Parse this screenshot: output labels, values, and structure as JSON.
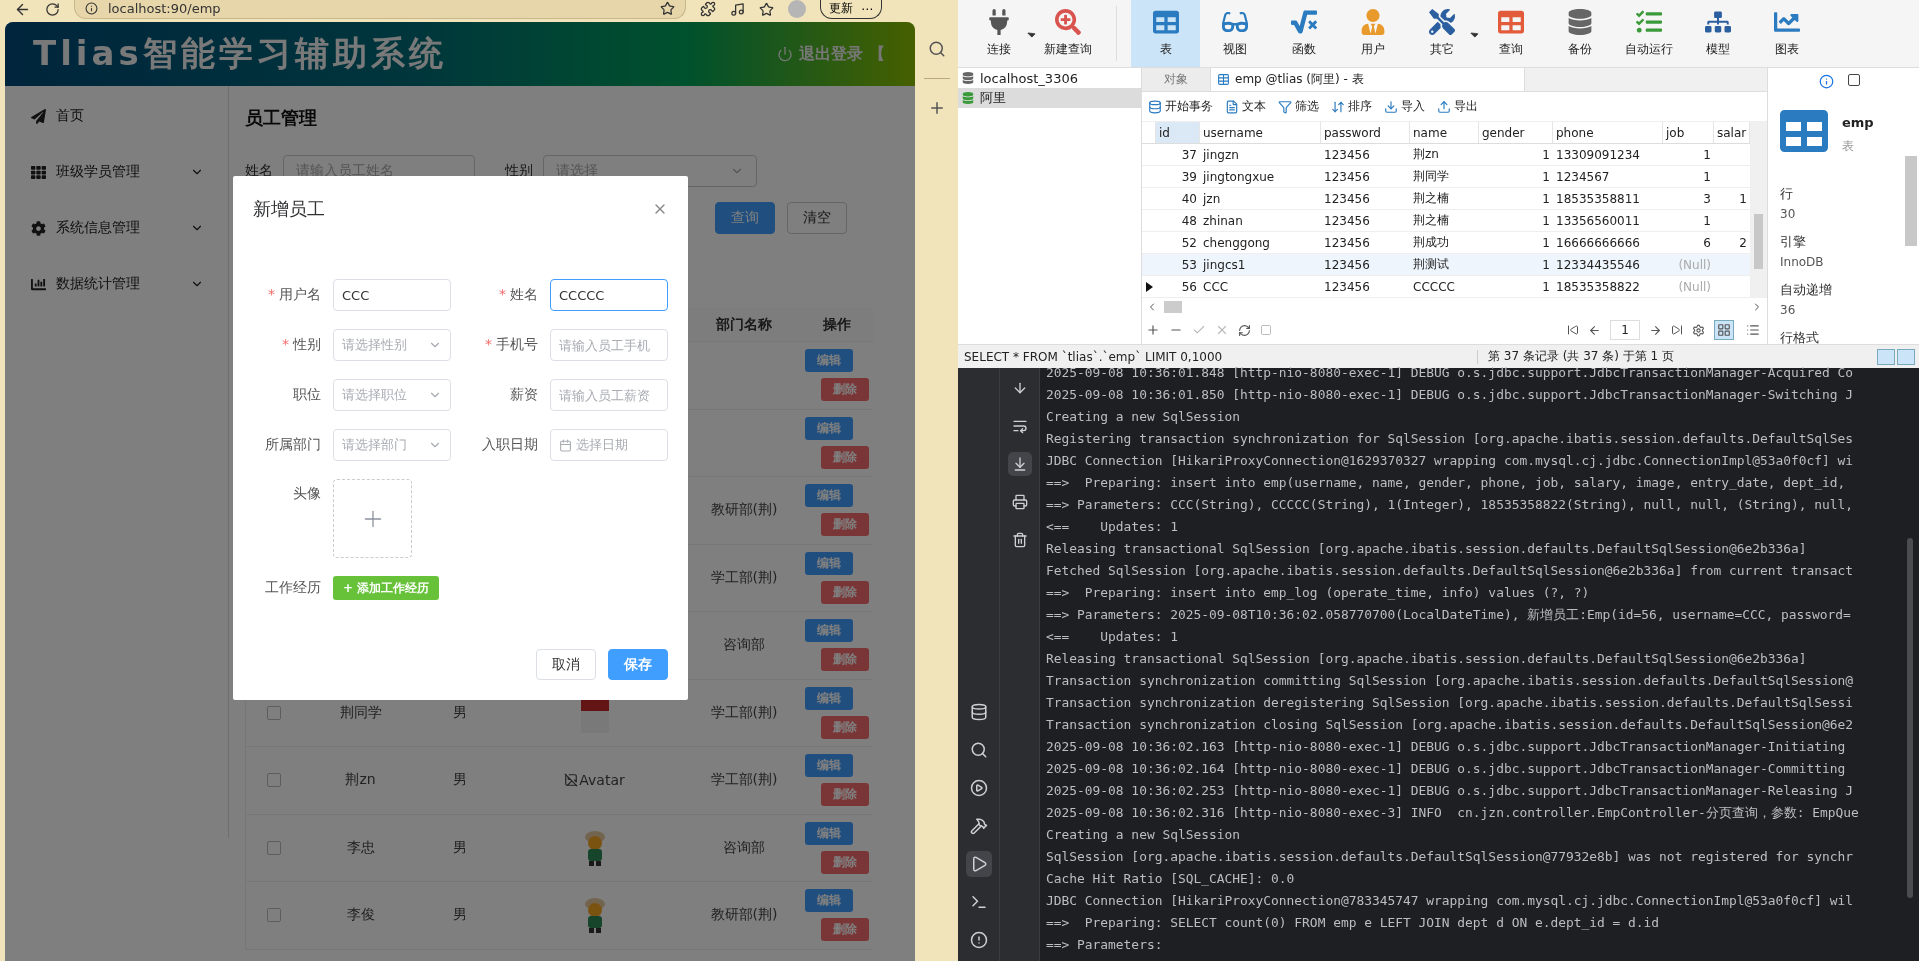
{
  "browser": {
    "url": "localhost:90/emp",
    "update_button": "更新",
    "more_button": "⋯"
  },
  "app": {
    "title": "Tlias智能学习辅助系统",
    "logout": "退出登录",
    "logout_extra": "【",
    "menu": [
      {
        "label": "首页",
        "kind": "home",
        "expandable": false
      },
      {
        "label": "班级学员管理",
        "kind": "grid",
        "expandable": true
      },
      {
        "label": "系统信息管理",
        "kind": "settings",
        "expandable": true
      },
      {
        "label": "数据统计管理",
        "kind": "chart",
        "expandable": true
      }
    ],
    "page": {
      "title": "员工管理",
      "search_fields": [
        {
          "label": "姓名",
          "kind": "input",
          "placeholder": "请输入员工姓名"
        },
        {
          "label": "性别",
          "kind": "select",
          "placeholder": "请选择"
        }
      ],
      "buttons": [
        {
          "label": "查询",
          "primary": true
        },
        {
          "label": "清空",
          "primary": false
        }
      ],
      "table": {
        "columns": [
          "部门名称",
          "操作"
        ],
        "rows": [
          {
            "edit": "编辑",
            "delete": "删除"
          },
          {
            "edit": "编辑",
            "delete": "删除"
          },
          {
            "dept": "教研部(荆)",
            "edit": "编辑",
            "delete": "删除"
          },
          {
            "dept": "学工部(荆)",
            "edit": "编辑",
            "delete": "删除"
          },
          {
            "dept": "咨询部",
            "edit": "编辑",
            "delete": "删除"
          },
          {
            "checked": false,
            "name": "荆同学",
            "gender": "男",
            "kind": "photo",
            "dept": "学工部(荆)",
            "edit": "编辑",
            "delete": "删除"
          },
          {
            "checked": false,
            "name": "荆zn",
            "gender": "男",
            "kind": "broken",
            "image_alt": "Avatar",
            "dept": "学工部(荆)",
            "edit": "编辑",
            "delete": "删除"
          },
          {
            "checked": false,
            "name": "李忠",
            "gender": "男",
            "kind": "cartoon",
            "dept": "咨询部",
            "edit": "编辑",
            "delete": "删除"
          },
          {
            "checked": false,
            "name": "李俊",
            "gender": "男",
            "kind": "cartoon",
            "dept": "教研部(荆)",
            "edit": "编辑",
            "delete": "删除"
          }
        ]
      }
    },
    "dialog": {
      "title": "新增员工",
      "fields": [
        {
          "label": "用户名",
          "required_mark": "*",
          "kind": "input",
          "value": "CCC",
          "focused": false
        },
        {
          "label": "姓名",
          "required_mark": "*",
          "kind": "input",
          "value": "CCCCC",
          "focused": true
        },
        {
          "label": "性别",
          "required_mark": "*",
          "kind": "select",
          "placeholder": "请选择性别",
          "focused": false
        },
        {
          "label": "手机号",
          "required_mark": "*",
          "kind": "input",
          "placeholder": "请输入员工手机",
          "focused": false
        },
        {
          "label": "职位",
          "kind": "select",
          "placeholder": "请选择职位",
          "focused": false
        },
        {
          "label": "薪资",
          "kind": "input",
          "placeholder": "请输入员工薪资",
          "focused": false
        },
        {
          "label": "所属部门",
          "kind": "select",
          "placeholder": "请选择部门",
          "focused": false
        },
        {
          "label": "入职日期",
          "kind": "date",
          "placeholder": "选择日期",
          "focused": false
        }
      ],
      "avatar_label": "头像",
      "experience_label": "工作经历",
      "add_experience_button": "+ 添加工作经历",
      "cancel_button": "取消",
      "save_button": "保存"
    }
  },
  "navicat": {
    "toolbar": [
      {
        "label": "连接",
        "kind": "connect",
        "selected": false,
        "dropdown": true
      },
      {
        "label": "新建查询",
        "kind": "new-query",
        "selected": false,
        "dropdown": false
      },
      {
        "label": "表",
        "kind": "table",
        "selected": true,
        "dropdown": false
      },
      {
        "label": "视图",
        "kind": "view",
        "selected": false,
        "dropdown": false
      },
      {
        "label": "函数",
        "kind": "function",
        "selected": false,
        "dropdown": false
      },
      {
        "label": "用户",
        "kind": "user",
        "selected": false,
        "dropdown": false
      },
      {
        "label": "其它",
        "kind": "other",
        "selected": false,
        "dropdown": true
      },
      {
        "label": "查询",
        "kind": "query",
        "selected": false,
        "dropdown": false
      },
      {
        "label": "备份",
        "kind": "backup",
        "selected": false,
        "dropdown": false
      },
      {
        "label": "自动运行",
        "kind": "auto",
        "selected": false,
        "dropdown": false
      },
      {
        "label": "模型",
        "kind": "model",
        "selected": false,
        "dropdown": false
      },
      {
        "label": "图表",
        "kind": "chart",
        "selected": false,
        "dropdown": false
      }
    ],
    "connections": [
      {
        "label": "localhost_3306",
        "selected": false
      },
      {
        "label": "阿里",
        "selected": true
      }
    ],
    "tabs": [
      {
        "label": "对象",
        "selected": false
      },
      {
        "label": "emp @tlias (阿里) - 表",
        "selected": true
      }
    ],
    "actions": [
      {
        "label": "开始事务",
        "kind": "begin"
      },
      {
        "label": "文本",
        "kind": "text"
      },
      {
        "label": "筛选",
        "kind": "filter"
      },
      {
        "label": "排序",
        "kind": "sort"
      },
      {
        "label": "导入",
        "kind": "import"
      },
      {
        "label": "导出",
        "kind": "export"
      }
    ],
    "grid": {
      "columns": [
        "id",
        "username",
        "password",
        "name",
        "gender",
        "phone",
        "job",
        "salar"
      ],
      "rows": [
        {
          "id": "37",
          "username": "jingzn",
          "password": "123456",
          "name": "荆zn",
          "gender": "1",
          "phone": "13309091234",
          "job": "1",
          "job_null": false,
          "current": false,
          "hovered": false
        },
        {
          "id": "39",
          "username": "jingtongxue",
          "password": "123456",
          "name": "荆同学",
          "gender": "1",
          "phone": "1234567",
          "job": "1",
          "job_null": false,
          "current": false,
          "hovered": false
        },
        {
          "id": "40",
          "username": "jzn",
          "password": "123456",
          "name": "荆之楠",
          "gender": "1",
          "phone": "18535358811",
          "job": "3",
          "job_null": false,
          "salary": "1",
          "current": false,
          "hovered": false
        },
        {
          "id": "48",
          "username": "zhinan",
          "password": "123456",
          "name": "荆之楠",
          "gender": "1",
          "phone": "13356560011",
          "job": "1",
          "job_null": false,
          "current": false,
          "hovered": false
        },
        {
          "id": "52",
          "username": "chenggong",
          "password": "123456",
          "name": "荆成功",
          "gender": "1",
          "phone": "16666666666",
          "job": "6",
          "job_null": false,
          "salary": "2",
          "current": false,
          "hovered": false
        },
        {
          "id": "53",
          "username": "jingcs1",
          "password": "123456",
          "name": "荆测试",
          "gender": "1",
          "phone": "12334435546",
          "job": "(Null)",
          "job_null": true,
          "current": false,
          "hovered": true
        },
        {
          "id": "56",
          "username": "CCC",
          "password": "123456",
          "name": "CCCCC",
          "gender": "1",
          "phone": "18535358822",
          "job": "(Null)",
          "job_null": true,
          "current": true,
          "hovered": false
        }
      ]
    },
    "page_number": "1",
    "info": {
      "name": "emp",
      "type": "表",
      "props": [
        {
          "label": "行",
          "value": "30"
        },
        {
          "label": "引擎",
          "value": "InnoDB"
        },
        {
          "label": "自动递增",
          "value": "36"
        },
        {
          "label": "行格式"
        }
      ]
    },
    "status_sql": "SELECT * FROM `tlias`.`emp` LIMIT 0,1000",
    "status_records": "第 37 条记录 (共 37 条) 于第 1 页"
  },
  "console": {
    "bar_tools": [
      {
        "kind": "down",
        "selected": false
      },
      {
        "kind": "wrap",
        "selected": false
      },
      {
        "kind": "scroll-end",
        "selected": true
      },
      {
        "kind": "print",
        "selected": false
      },
      {
        "kind": "trash",
        "selected": false
      }
    ],
    "side_tools": [
      {
        "kind": "database",
        "selected": false
      },
      {
        "kind": "search",
        "selected": false
      },
      {
        "kind": "services",
        "selected": false
      },
      {
        "kind": "build",
        "selected": false
      },
      {
        "kind": "run",
        "selected": true
      },
      {
        "kind": "terminal",
        "selected": false
      },
      {
        "kind": "problems",
        "selected": false
      }
    ],
    "lines": [
      "2025-09-08 10:36:01.848 [http-nio-8080-exec-1] DEBUG o.s.jdbc.support.JdbcTransactionManager-Acquired Co",
      "2025-09-08 10:36:01.850 [http-nio-8080-exec-1] DEBUG o.s.jdbc.support.JdbcTransactionManager-Switching J",
      "Creating a new SqlSession",
      "Registering transaction synchronization for SqlSession [org.apache.ibatis.session.defaults.DefaultSqlSes",
      "JDBC Connection [HikariProxyConnection@1629370327 wrapping com.mysql.cj.jdbc.ConnectionImpl@53a0f0cf] wi",
      "==>  Preparing: insert into emp(username, name, gender, phone, job, salary, image, entry_date, dept_id,",
      "==> Parameters: CCC(String), CCCCC(String), 1(Integer), 18535358822(String), null, null, (String), null,",
      "<==    Updates: 1",
      "Releasing transactional SqlSession [org.apache.ibatis.session.defaults.DefaultSqlSession@6e2b336a]",
      "Fetched SqlSession [org.apache.ibatis.session.defaults.DefaultSqlSession@6e2b336a] from current transact",
      "==>  Preparing: insert into emp_log (operate_time, info) values (?, ?)",
      "==> Parameters: 2025-09-08T10:36:02.058770700(LocalDateTime), 新增员工:Emp(id=56, username=CCC, password=",
      "<==    Updates: 1",
      "Releasing transactional SqlSession [org.apache.ibatis.session.defaults.DefaultSqlSession@6e2b336a]",
      "Transaction synchronization committing SqlSession [org.apache.ibatis.session.defaults.DefaultSqlSession@",
      "Transaction synchronization deregistering SqlSession [org.apache.ibatis.session.defaults.DefaultSqlSessi",
      "Transaction synchronization closing SqlSession [org.apache.ibatis.session.defaults.DefaultSqlSession@6e2",
      "2025-09-08 10:36:02.163 [http-nio-8080-exec-1] DEBUG o.s.jdbc.support.JdbcTransactionManager-Initiating",
      "2025-09-08 10:36:02.164 [http-nio-8080-exec-1] DEBUG o.s.jdbc.support.JdbcTransactionManager-Committing",
      "2025-09-08 10:36:02.253 [http-nio-8080-exec-1] DEBUG o.s.jdbc.support.JdbcTransactionManager-Releasing J",
      "2025-09-08 10:36:02.316 [http-nio-8080-exec-3] INFO  cn.jzn.controller.EmpController-分页查询，参数: EmpQue",
      "Creating a new SqlSession",
      "SqlSession [org.apache.ibatis.session.defaults.DefaultSqlSession@77932e8b] was not registered for synchr",
      "Cache Hit Ratio [SQL_CACHE]: 0.0",
      "JDBC Connection [HikariProxyConnection@783345747 wrapping com.mysql.cj.jdbc.ConnectionImpl@53a0f0cf] wil",
      "==>  Preparing: SELECT count(0) FROM emp e LEFT JOIN dept d ON e.dept_id = d.id",
      "==> Parameters:"
    ]
  }
}
